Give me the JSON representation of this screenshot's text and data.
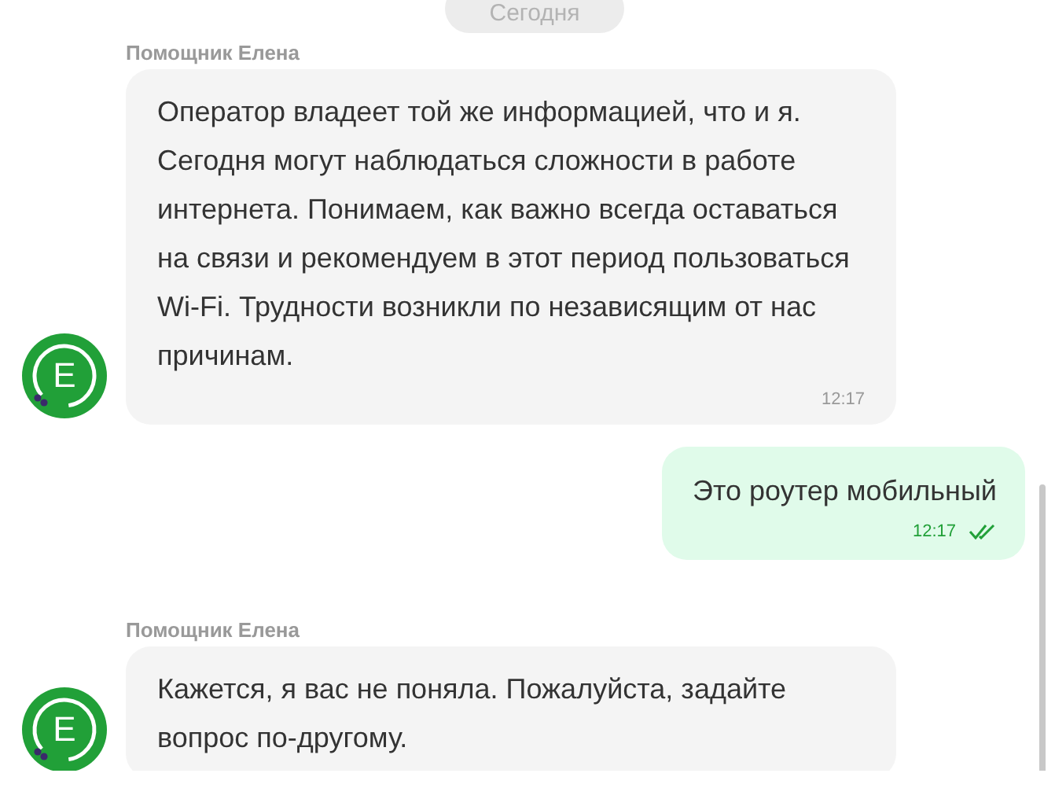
{
  "date_divider": "Сегодня",
  "messages": [
    {
      "kind": "incoming",
      "sender": "Помощник Елена",
      "avatar": "Е",
      "text": "Оператор владеет той же информацией, что и я. Сегодня могут наблюдаться сложности в работе интернета. Понимаем, как важно всегда оставаться на связи и рекомендуем в этот период пользоваться Wi-Fi. Трудности возникли по независящим от нас причинам.",
      "time": "12:17"
    },
    {
      "kind": "outgoing",
      "text": "Это роутер мобильный",
      "time": "12:17",
      "read": true
    },
    {
      "kind": "incoming",
      "sender": "Помощник Елена",
      "avatar": "Е",
      "text": "Кажется, я вас не поняла. Пожалуйста, задайте вопрос по-другому."
    }
  ]
}
